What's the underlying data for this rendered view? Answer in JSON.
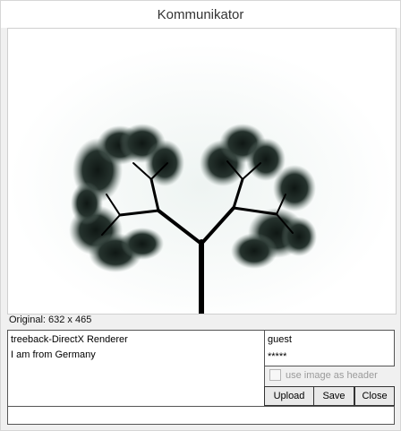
{
  "window": {
    "title": "Kommunikator"
  },
  "image": {
    "caption": "Original: 632 x 465",
    "trunk_color": "#000000",
    "foliage_color": "#1e2b26"
  },
  "form": {
    "title_value": "treeback-DirectX Renderer",
    "user_value": "guest",
    "message_value": "I am from Germany",
    "password_value": "*****",
    "header_checkbox_label": "use image as header",
    "header_checkbox_checked": false
  },
  "buttons": {
    "upload": "Upload",
    "save": "Save",
    "close": "Close"
  },
  "status": {
    "text": ""
  }
}
